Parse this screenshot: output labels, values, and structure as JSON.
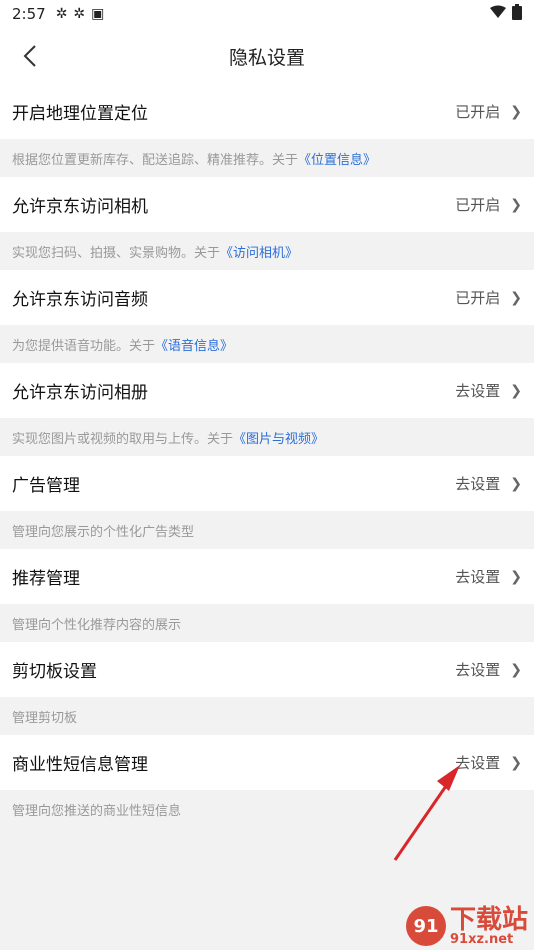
{
  "status_bar": {
    "time": "2:57"
  },
  "header": {
    "title": "隐私设置"
  },
  "rows": [
    {
      "label": "开启地理位置定位",
      "status": "已开启",
      "desc_prefix": "根据您位置更新库存、配送追踪、精准推荐。关于",
      "desc_link": "《位置信息》"
    },
    {
      "label": "允许京东访问相机",
      "status": "已开启",
      "desc_prefix": "实现您扫码、拍摄、实景购物。关于",
      "desc_link": "《访问相机》"
    },
    {
      "label": "允许京东访问音频",
      "status": "已开启",
      "desc_prefix": "为您提供语音功能。关于",
      "desc_link": "《语音信息》"
    },
    {
      "label": "允许京东访问相册",
      "status": "去设置",
      "desc_prefix": "实现您图片或视频的取用与上传。关于",
      "desc_link": "《图片与视频》"
    },
    {
      "label": "广告管理",
      "status": "去设置",
      "desc_prefix": "管理向您展示的个性化广告类型",
      "desc_link": ""
    },
    {
      "label": "推荐管理",
      "status": "去设置",
      "desc_prefix": "管理向个性化推荐内容的展示",
      "desc_link": ""
    },
    {
      "label": "剪切板设置",
      "status": "去设置",
      "desc_prefix": "管理剪切板",
      "desc_link": ""
    },
    {
      "label": "商业性短信息管理",
      "status": "去设置",
      "desc_prefix": "管理向您推送的商业性短信息",
      "desc_link": ""
    }
  ],
  "colors": {
    "link": "#2b6fd8",
    "arrow": "#d8262a"
  },
  "watermark": {
    "name": "下载站",
    "url": "91xz.net",
    "badge": "91"
  }
}
